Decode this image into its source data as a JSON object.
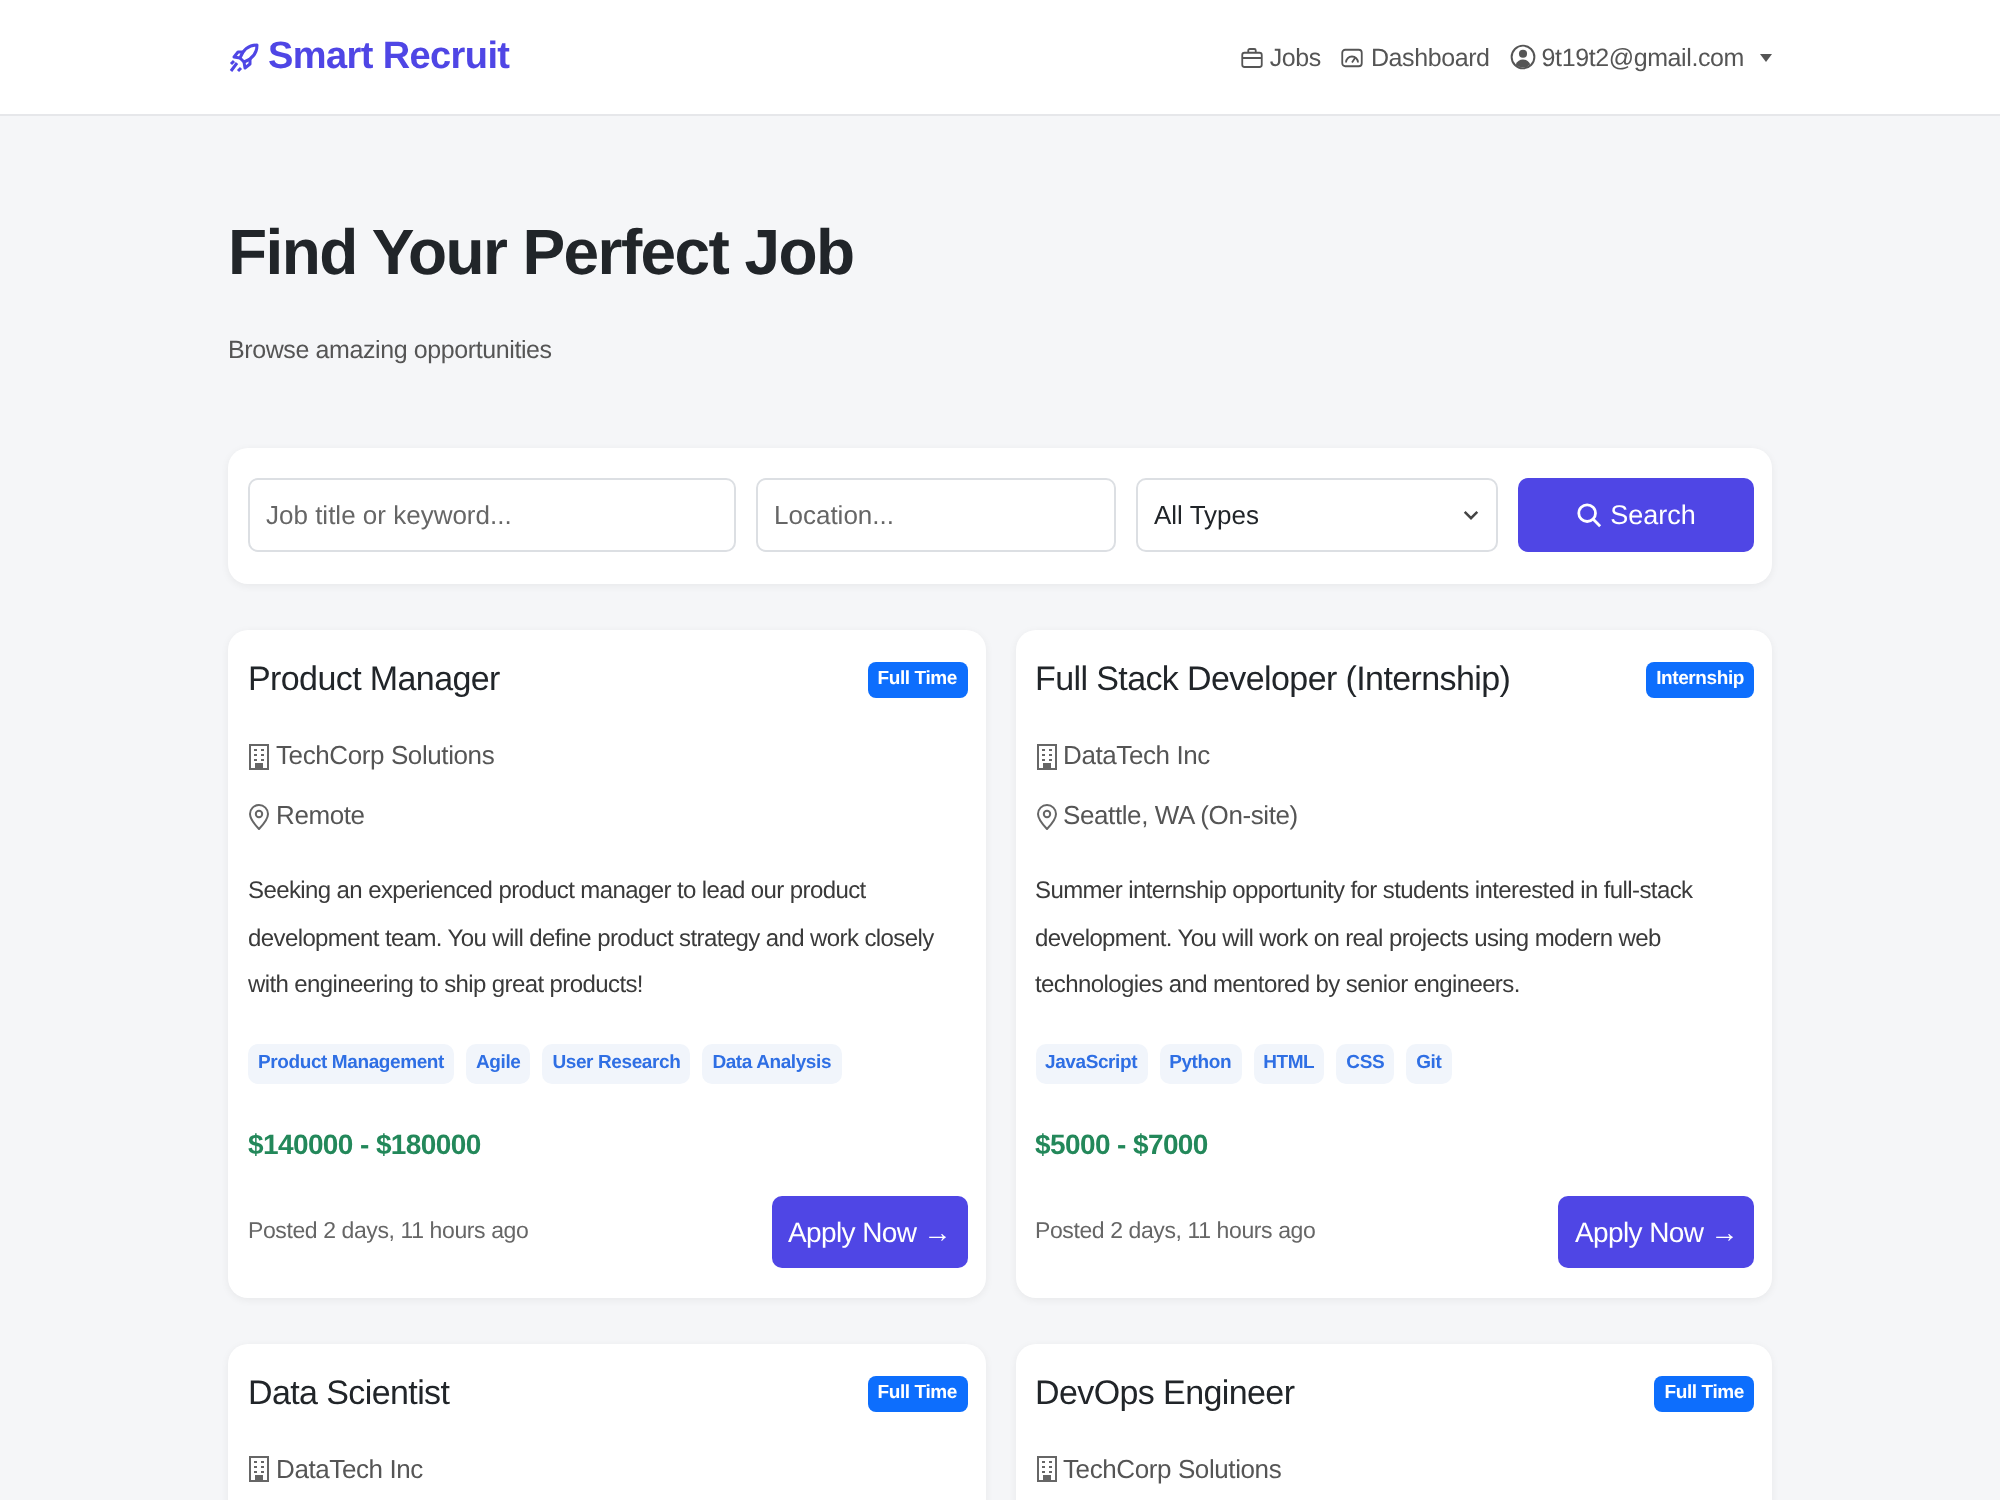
{
  "navbar": {
    "brand": "Smart Recruit",
    "links": [
      {
        "label": "Jobs",
        "kind": "jobs"
      },
      {
        "label": "Dashboard",
        "kind": "dashboard"
      }
    ],
    "user": {
      "email": "9t19t2@gmail.com"
    }
  },
  "header": {
    "title": "Find Your Perfect Job",
    "subtitle": "Browse amazing opportunities"
  },
  "search": {
    "keyword_placeholder": "Job title or keyword...",
    "location_placeholder": "Location...",
    "type_select": "All Types",
    "button": "Search"
  },
  "jobs": [
    {
      "title": "Product Manager",
      "type": "Full Time",
      "company": "TechCorp Solutions",
      "location": "Remote",
      "description": "Seeking an experienced product manager to lead our product development team. You will define product strategy and work closely with engineering to ship great products!",
      "skills": [
        "Product Management",
        "Agile",
        "User Research",
        "Data Analysis"
      ],
      "salary": "$140000 - $180000",
      "posted": "Posted 2 days, 11 hours ago",
      "apply_button": "Apply Now →"
    },
    {
      "title": "Full Stack Developer (Internship)",
      "type": "Internship",
      "company": "DataTech Inc",
      "location": "Seattle, WA (On-site)",
      "description": "Summer internship opportunity for students interested in full-stack development. You will work on real projects using modern web technologies and mentored by senior engineers.",
      "skills": [
        "JavaScript",
        "Python",
        "HTML",
        "CSS",
        "Git"
      ],
      "salary": "$5000 - $7000",
      "posted": "Posted 2 days, 11 hours ago",
      "apply_button": "Apply Now →"
    },
    {
      "title": "Data Scientist",
      "type": "Full Time",
      "company": "DataTech Inc"
    },
    {
      "title": "DevOps Engineer",
      "type": "Full Time",
      "company": "TechCorp Solutions"
    }
  ]
}
